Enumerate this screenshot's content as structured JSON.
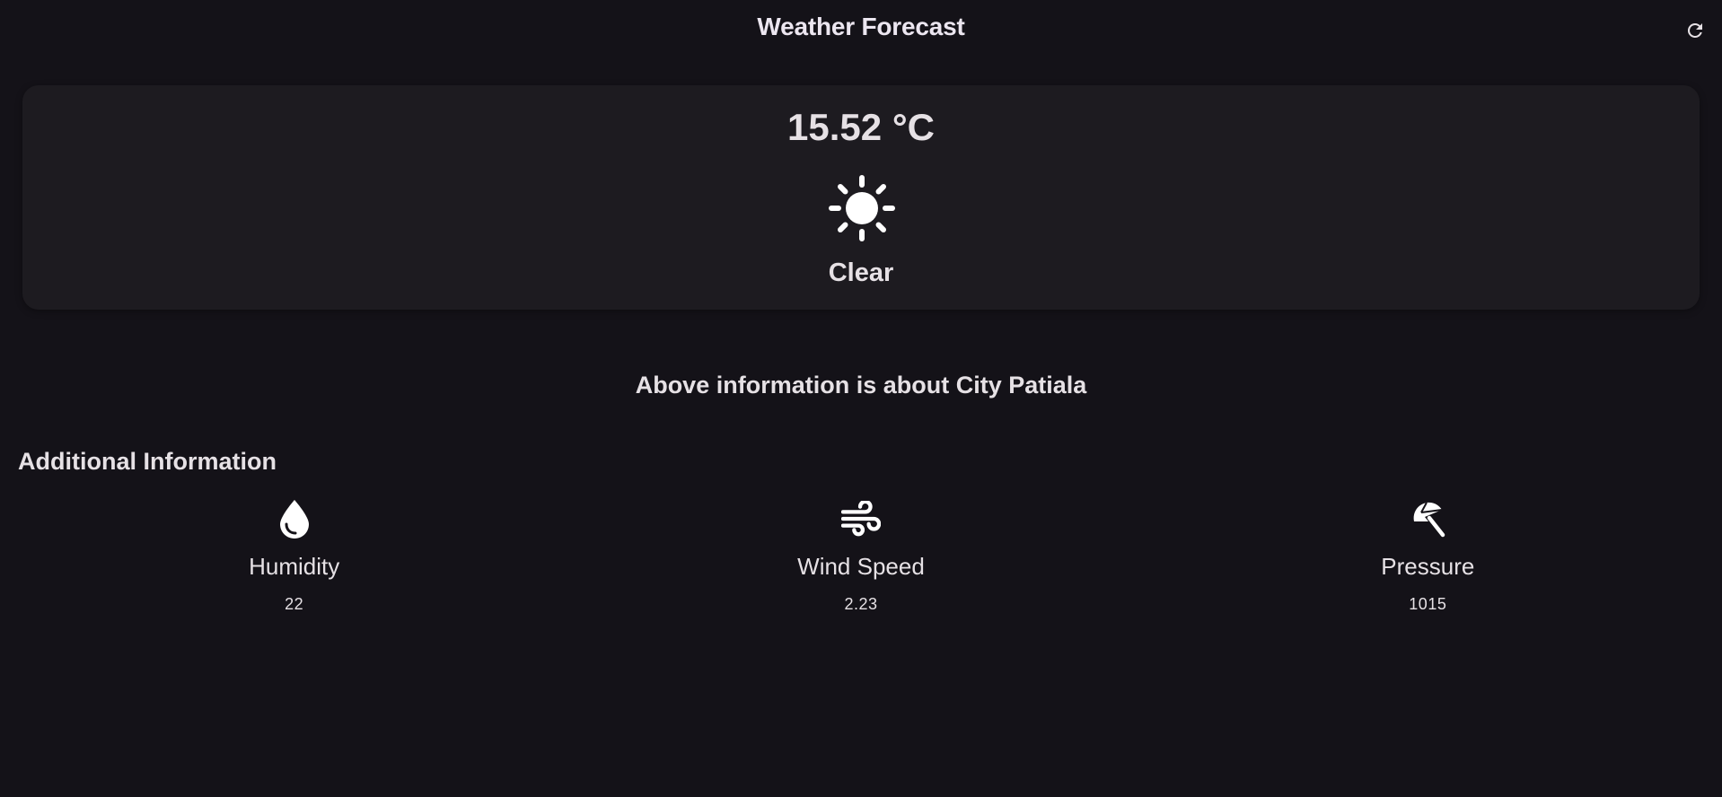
{
  "app": {
    "title": "Weather Forecast",
    "refresh_icon": "refresh-icon"
  },
  "current": {
    "temperature": "15.52 °C",
    "condition_icon": "sun-icon",
    "condition": "Clear"
  },
  "location_text": "Above information is about City Patiala",
  "additional": {
    "title": "Additional Information",
    "items": [
      {
        "icon": "water-drop-icon",
        "label": "Humidity",
        "value": "22"
      },
      {
        "icon": "wind-icon",
        "label": "Wind Speed",
        "value": "2.23"
      },
      {
        "icon": "beach-umbrella-icon",
        "label": "Pressure",
        "value": "1015"
      }
    ]
  },
  "colors": {
    "background": "#141218",
    "card": "#1d1b20",
    "text": "#e6e1e5",
    "icon": "#ffffff"
  }
}
